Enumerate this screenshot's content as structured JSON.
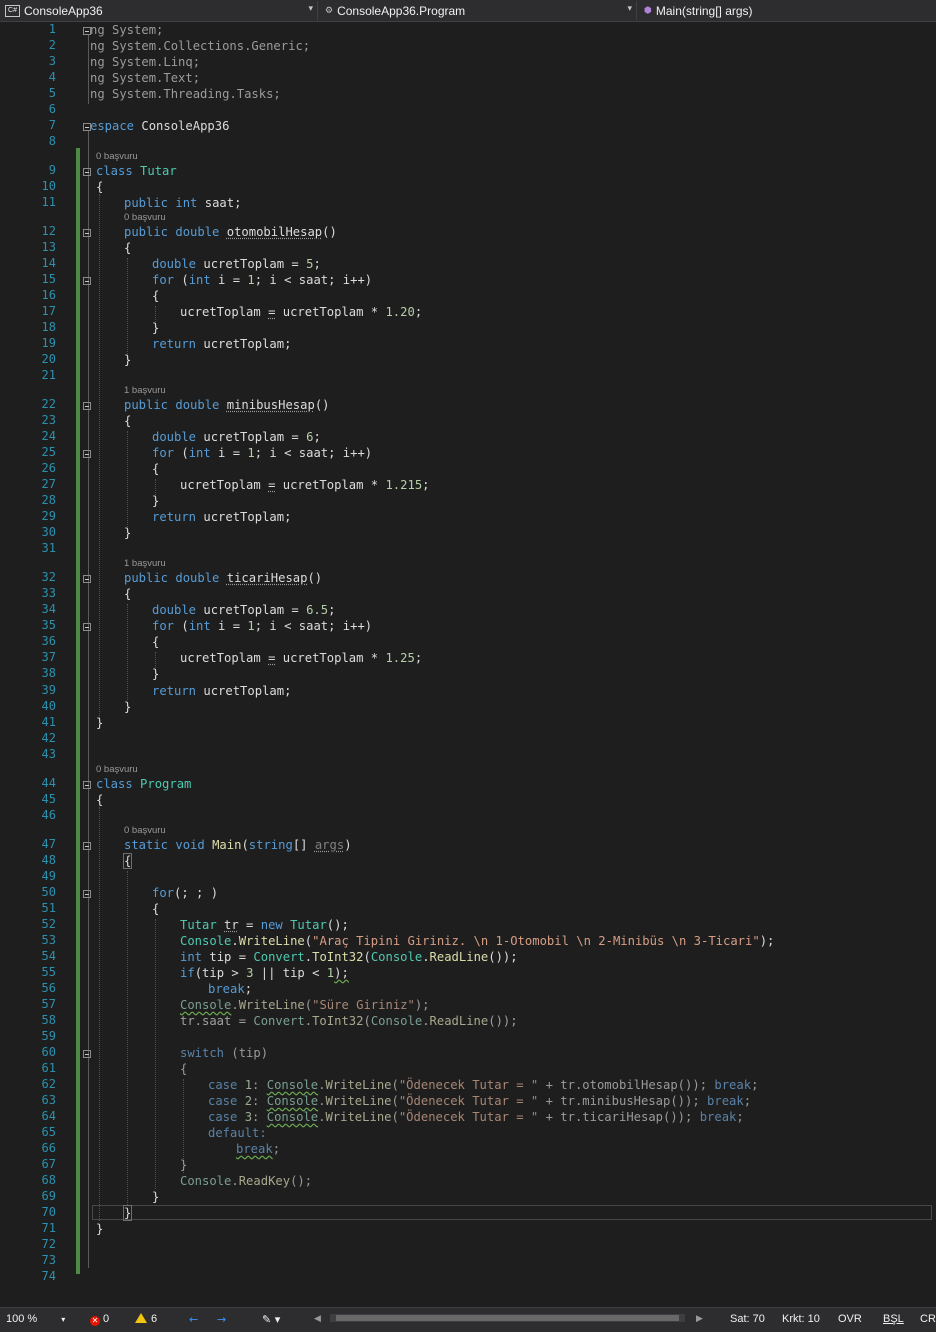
{
  "navbar": {
    "project": "ConsoleApp36",
    "class_path": "ConsoleApp36.Program",
    "member": "Main(string[] args)"
  },
  "editor": {
    "line_numbers": [
      "1",
      "2",
      "3",
      "4",
      "5",
      "6",
      "7",
      "8",
      "9",
      "10",
      "11",
      "12",
      "13",
      "14",
      "15",
      "16",
      "17",
      "18",
      "19",
      "20",
      "21",
      "22",
      "23",
      "24",
      "25",
      "26",
      "27",
      "28",
      "29",
      "30",
      "31",
      "32",
      "33",
      "34",
      "35",
      "36",
      "37",
      "38",
      "39",
      "40",
      "41",
      "42",
      "43",
      "44",
      "45",
      "46",
      "47",
      "48",
      "49",
      "50",
      "51",
      "52",
      "53",
      "54",
      "55",
      "56",
      "57",
      "58",
      "59",
      "60",
      "61",
      "62",
      "63",
      "64",
      "65",
      "66",
      "67",
      "68",
      "69",
      "70",
      "71",
      "72",
      "73",
      "74"
    ],
    "references": {
      "r9": "0 başvuru",
      "r12": "0 başvuru",
      "r22": "1 başvuru",
      "r32": "1 başvuru",
      "r44": "0 başvuru",
      "r47": "0 başvuru"
    },
    "code": {
      "l1": "ng System;",
      "l2": "ng System.Collections.Generic;",
      "l3": "ng System.Linq;",
      "l4": "ng System.Text;",
      "l5": "ng System.Threading.Tasks;",
      "l7_kw": "espace",
      "l7_name": " ConsoleApp36",
      "class": "class",
      "tutar": "Tutar",
      "program": "Program",
      "open_brace": "{",
      "close_brace": "}",
      "public": "public",
      "int": "int",
      "double": "double",
      "saat_decl": " saat;",
      "otomobil": "otomobilHesap",
      "minibus": "minibusHesap",
      "ticari": "ticariHesap",
      "parens": "()",
      "ucret": " ucretToplam = ",
      "v5": "5",
      "v6": "6",
      "v65": "6.5",
      "semi": ";",
      "for": "for",
      "for_open": " (",
      "for_mid": " i = ",
      "one": "1",
      "for_cond": "; i < saat; i++)",
      "ucret_assign_a": "ucretToplam ",
      "eq": "=",
      "ucret_assign_b": " ucretToplam * ",
      "m120": "1.20",
      "m1215": "1.215",
      "m125": "1.25",
      "return": "return",
      "ret_val": " ucretToplam;",
      "static": "static",
      "void": "void",
      "main": "Main",
      "string": "string",
      "args_pre": "[] ",
      "args": "args",
      "close_paren": ")",
      "for_inf": "(; ; )",
      "new": "new",
      "tr": "tr",
      "l52_mid": " = ",
      "l52_end": "();",
      "console": "Console",
      "writeline": "WriteLine",
      "s53": "\"Araç Tipini Giriniz. \\n 1-Otomobil \\n 2-Minibüs \\n 3-Ticari\"",
      "end_call": ");",
      "tip_decl": " tip = ",
      "convert": "Convert",
      "toint": "ToInt32",
      "readline": "ReadLine",
      "readline_end": "());",
      "if": "if",
      "if_a": "(tip > ",
      "three": "3",
      "if_b": " || tip < ",
      "if_c": ");",
      "break": "break",
      "s57": "\"Süre Giriniz\"",
      "tr_saat": "tr.saat = ",
      "switch": "switch",
      "switch_arg": " (tip)",
      "case": "case",
      "c1": "1",
      "c2": "2",
      "c3": "3",
      "s_odenecek": "\"Ödenecek Tutar = \"",
      "plus": " + ",
      "tr_oto": "tr.otomobilHesap());",
      "tr_min": "tr.minibusHesap());",
      "tr_tic": "tr.ticariHesap());",
      "default": "default:",
      "readkey": "ReadKey",
      "readkey_end": "();"
    }
  },
  "status": {
    "zoom": "100 %",
    "errors": "0",
    "warnings": "6",
    "line": "Sat: 70",
    "col": "Krkt: 10",
    "ovr": "OVR",
    "bsl": "BŞL",
    "crlf": "CRLF"
  }
}
